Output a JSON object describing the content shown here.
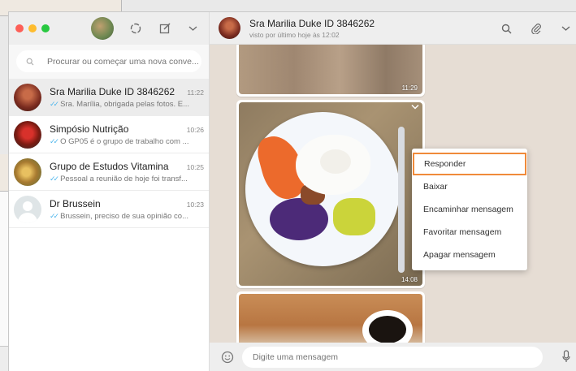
{
  "background": {
    "bottom_toolbar_icons": [
      "search-icon",
      "paperclip-icon",
      "chevron-down-icon"
    ]
  },
  "sidebar": {
    "header_icons": [
      "status-icon",
      "new-chat-icon",
      "chevron-down-icon"
    ],
    "search_placeholder": "Procurar ou começar uma nova conve...",
    "chats": [
      {
        "name": "Sra Marilia Duke ID 3846262",
        "time": "11:22",
        "preview": "Sra. Marília, obrigada pelas fotos. E...",
        "active": true
      },
      {
        "name": "Simpósio Nutrição",
        "time": "10:26",
        "preview": "O GP05 é o grupo de trabalho com ..."
      },
      {
        "name": "Grupo de Estudos Vitamina",
        "time": "10:25",
        "preview": "Pessoal a reunião de hoje foi transf..."
      },
      {
        "name": "Dr Brussein",
        "time": "10:23",
        "preview": "Brussein, preciso de sua opinião co..."
      }
    ]
  },
  "conversation": {
    "name": "Sra Marilia Duke ID 3846262",
    "status": "visto por último hoje às 12:02",
    "header_icons": [
      "search-icon",
      "paperclip-icon",
      "chevron-down-icon"
    ],
    "messages": [
      {
        "type": "image",
        "subject": "wooden table",
        "time": "11:29"
      },
      {
        "type": "image",
        "subject": "plate with vegetables and egg",
        "time": "14:08"
      },
      {
        "type": "image",
        "subject": "cup of coffee"
      }
    ],
    "context_menu": [
      {
        "label": "Responder",
        "highlighted": true
      },
      {
        "label": "Baixar"
      },
      {
        "label": "Encaminhar mensagem"
      },
      {
        "label": "Favoritar mensagem"
      },
      {
        "label": "Apagar mensagem"
      }
    ],
    "composer_placeholder": "Digite uma mensagem"
  },
  "colors": {
    "tick_blue": "#4fb6ec",
    "highlight_orange": "#f08a3a",
    "chat_wallpaper": "#e6ddd4"
  }
}
